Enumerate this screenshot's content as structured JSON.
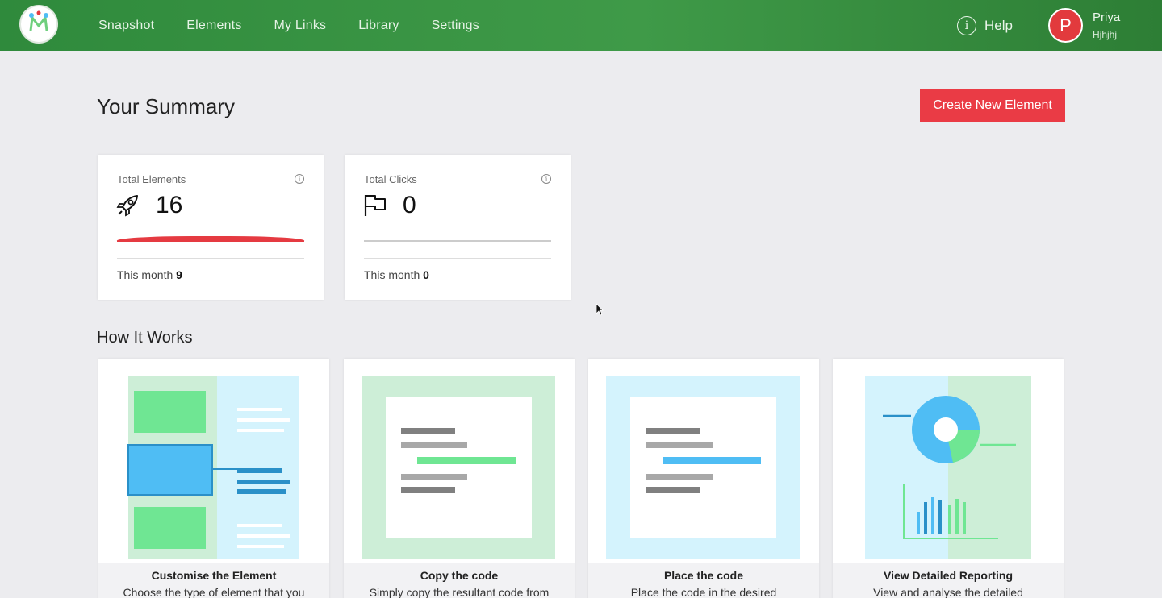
{
  "nav": {
    "items": [
      "Snapshot",
      "Elements",
      "My Links",
      "Library",
      "Settings"
    ],
    "help_label": "Help",
    "user": {
      "initial": "P",
      "name": "Priya",
      "subtitle": "Hjhjhj"
    }
  },
  "summary": {
    "title": "Your Summary",
    "create_button": "Create New Element",
    "cards": [
      {
        "label": "Total Elements",
        "value": "16",
        "month_label": "This month",
        "month_value": "9",
        "icon": "rocket-icon",
        "progress": 1.0
      },
      {
        "label": "Total Clicks",
        "value": "0",
        "month_label": "This month",
        "month_value": "0",
        "icon": "flag-icon",
        "progress": 0.0
      }
    ]
  },
  "how_it_works": {
    "title": "How It Works",
    "cards": [
      {
        "title": "Customise the Element",
        "desc": "Choose the type of element that you"
      },
      {
        "title": "Copy the code",
        "desc": "Simply copy the resultant code from"
      },
      {
        "title": "Place the code",
        "desc": "Place the code in the desired"
      },
      {
        "title": "View Detailed Reporting",
        "desc": "View and analyse the detailed"
      }
    ]
  },
  "colors": {
    "topbar": "#3f9a48",
    "accent": "#ea3b45",
    "green": "#6fe693",
    "blue": "#4fbdf4",
    "light_blue": "#d4f3fd",
    "light_green": "#cdeed7"
  }
}
